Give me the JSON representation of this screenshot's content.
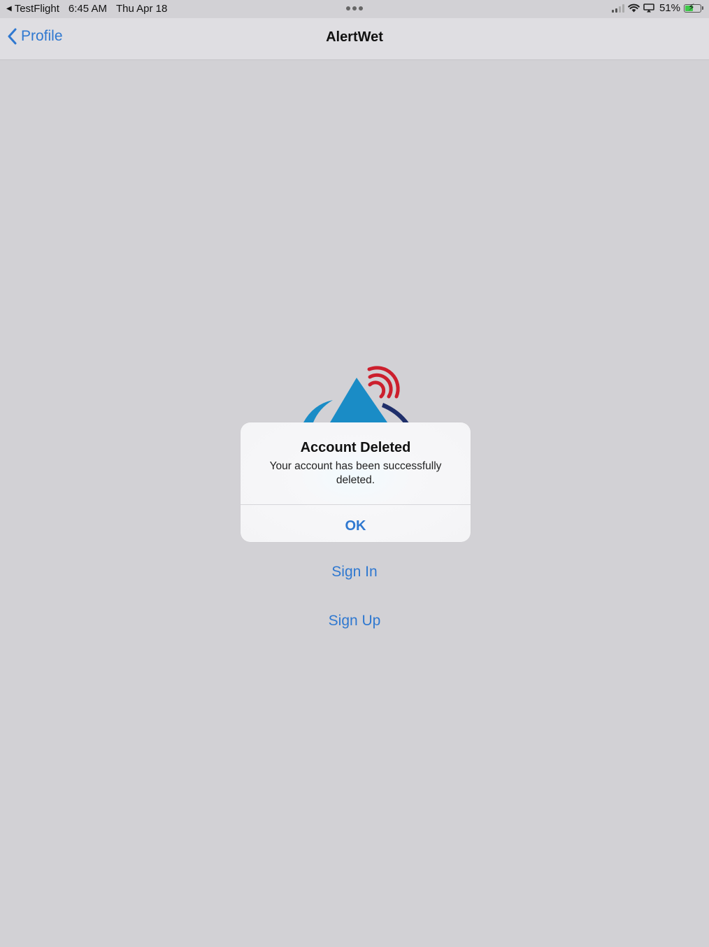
{
  "status_bar": {
    "back_app": "TestFlight",
    "time": "6:45 AM",
    "date": "Thu Apr 18",
    "battery_percent": "51%",
    "battery_level": 0.51,
    "battery_charging": true
  },
  "nav": {
    "back_label": "Profile",
    "title": "AlertWet"
  },
  "links": {
    "sign_in": "Sign In",
    "sign_up": "Sign Up"
  },
  "alert": {
    "title": "Account Deleted",
    "message": "Your account has been successfully deleted.",
    "ok_label": "OK"
  },
  "colors": {
    "accent": "#2f78d0",
    "background": "#d2d1d5",
    "logo_blue": "#1a8cc6",
    "logo_navy": "#1f2f6b",
    "logo_red": "#cc1f2d"
  },
  "icons": {
    "back": "chevron-left-icon",
    "wifi": "wifi-icon",
    "signal": "cellular-signal-icon",
    "airplay": "screen-mirroring-icon",
    "battery": "battery-charging-icon"
  }
}
